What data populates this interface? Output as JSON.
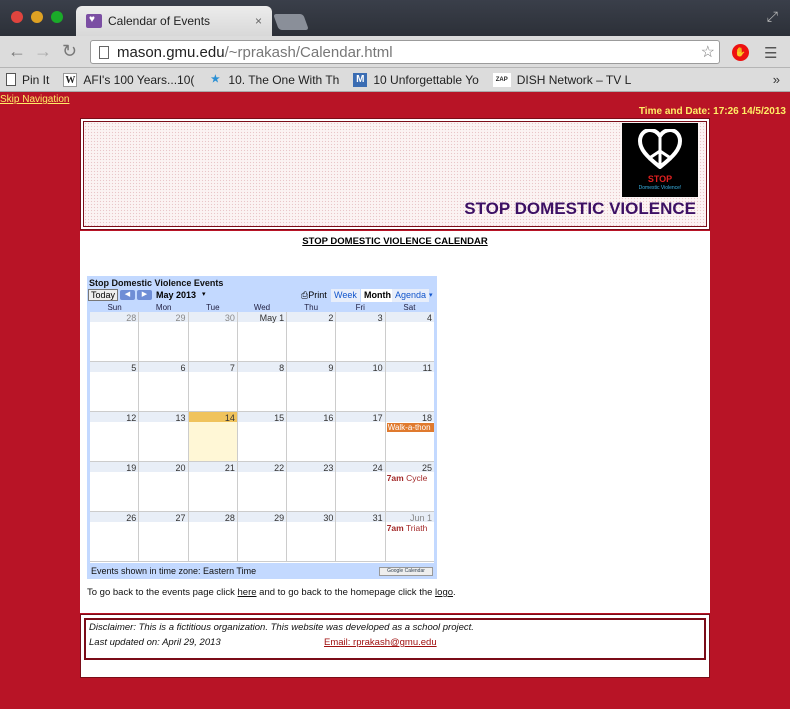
{
  "browser": {
    "tab_title": "Calendar of Events",
    "tab_close": "×",
    "url_host": "mason.gmu.edu",
    "url_path": "/~rprakash/Calendar.html",
    "stop_ext_label": "✋"
  },
  "bookmarks": [
    {
      "icon": "page-icon",
      "label": "Pin It"
    },
    {
      "icon": "wikipedia-icon",
      "icon_glyph": "W",
      "label": "AFI's 100 Years...10("
    },
    {
      "icon": "tvshow-icon",
      "icon_glyph": "★",
      "label": "10. The One With Th"
    },
    {
      "icon": "m-icon",
      "icon_glyph": "M",
      "label": "10 Unforgettable Yo"
    },
    {
      "icon": "zap2it-icon",
      "icon_glyph": "ZAP",
      "label": "DISH Network – TV L"
    }
  ],
  "bookmarks_more": "»",
  "page": {
    "skip_nav": "Skip Navigation",
    "datetime": "Time and Date: 17:26 14/5/2013",
    "banner_title": "STOP DOMESTIC VIOLENCE",
    "logo_stop": "STOP",
    "logo_sub": "Domestic Violence!",
    "calendar_heading": "STOP DOMESTIC VIOLENCE CALENDAR",
    "back_text_1": "To go back to the events page click ",
    "back_link_1": "here",
    "back_text_2": " and to go back to the homepage click the ",
    "back_link_2": "logo",
    "back_text_3": ".",
    "disclaimer": "Disclaimer: This is a fictitious organization. This website was developed as a school project.",
    "last_updated": "Last updated on: April 29, 2013",
    "email": "Email: rprakash@gmu.edu"
  },
  "gcal": {
    "title": "Stop Domestic Violence Events",
    "today_btn": "Today",
    "prev": "◀",
    "next": "▶",
    "month": "May 2013",
    "month_drop": "▾",
    "print": "⎙Print",
    "tab_week": "Week",
    "tab_month": "Month",
    "tab_agenda": "Agenda",
    "agenda_drop": "▾",
    "days_of_week": [
      "Sun",
      "Mon",
      "Tue",
      "Wed",
      "Thu",
      "Fri",
      "Sat"
    ],
    "weeks": [
      [
        "28",
        "29",
        "30",
        "May 1",
        "2",
        "3",
        "4"
      ],
      [
        "5",
        "6",
        "7",
        "8",
        "9",
        "10",
        "11"
      ],
      [
        "12",
        "13",
        "14",
        "15",
        "16",
        "17",
        "18"
      ],
      [
        "19",
        "20",
        "21",
        "22",
        "23",
        "24",
        "25"
      ],
      [
        "26",
        "27",
        "28",
        "29",
        "30",
        "31",
        "Jun 1"
      ]
    ],
    "events": {
      "walk": "Walk-a-thon",
      "cycle_time": "7am",
      "cycle_name": " Cycle",
      "tri_time": "7am",
      "tri_name": " Triath"
    },
    "footer": "Events shown in time zone: Eastern Time",
    "badge": "Google Calendar"
  }
}
